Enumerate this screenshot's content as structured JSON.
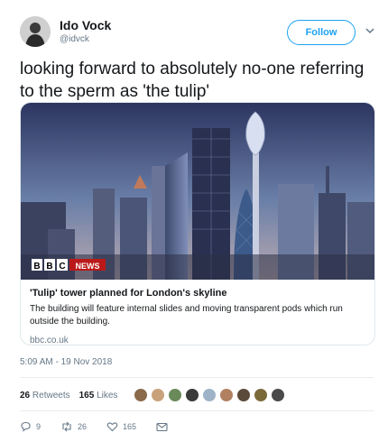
{
  "header": {
    "display_name": "Ido Vock",
    "handle": "@idvck",
    "follow_label": "Follow"
  },
  "tweet": {
    "text": "looking forward to absolutely no-one referring to the sperm as 'the tulip'"
  },
  "card": {
    "brand_logo_text": "BBC NEWS",
    "title": "'Tulip' tower planned for London's skyline",
    "description": "The building will feature internal slides and moving transparent pods which run outside the building.",
    "domain": "bbc.co.uk"
  },
  "timestamp": "5:09 AM - 19 Nov 2018",
  "stats": {
    "retweets_count": "26",
    "retweets_label": "Retweets",
    "likes_count": "165",
    "likes_label": "Likes",
    "liker_colors": [
      "#8a6a4a",
      "#c9a27c",
      "#6a8a5a",
      "#3a3a3a",
      "#9fb3c8",
      "#b08060",
      "#5a4a3a",
      "#7a6a3a",
      "#4a4a4a"
    ]
  },
  "actions": {
    "reply_count": "9",
    "retweet_count": "26",
    "like_count": "165"
  },
  "colors": {
    "accent": "#1da1f2",
    "secondary_text": "#657786",
    "bbc_red": "#bb1919"
  }
}
